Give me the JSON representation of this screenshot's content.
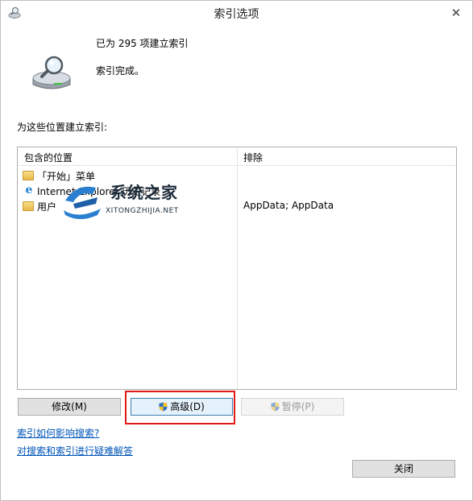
{
  "window": {
    "title": "索引选项",
    "close_glyph": "✕"
  },
  "status": {
    "line1": "已为 295 项建立索引",
    "line2": "索引完成。"
  },
  "section_label": "为这些位置建立索引:",
  "table": {
    "headers": {
      "included": "包含的位置",
      "exclude": "排除"
    },
    "rows": [
      {
        "icon": "folder-icon",
        "location": "「开始」菜单",
        "exclude": ""
      },
      {
        "icon": "internet-explorer-icon",
        "location": "Internet Explorer 历史记录",
        "exclude": ""
      },
      {
        "icon": "folder-icon",
        "location": "用户",
        "exclude": "AppData; AppData"
      }
    ]
  },
  "watermark": {
    "title": "系统之家",
    "subtitle": "XITONGZHIJIA.NET"
  },
  "buttons": {
    "modify": "修改(M)",
    "advanced": "高级(D)",
    "pause": "暂停(P)",
    "close": "关闭"
  },
  "links": {
    "how_indexing": "索引如何影响搜索?",
    "troubleshoot": "对搜索和索引进行疑难解答"
  },
  "colors": {
    "link": "#0055b8",
    "highlight": "#e01a1a",
    "accent": "#3c7fb1"
  }
}
